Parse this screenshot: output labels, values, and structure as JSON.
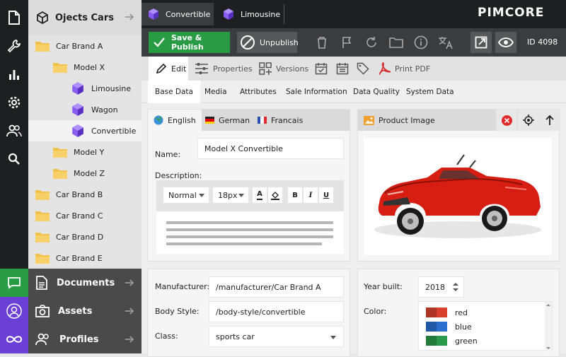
{
  "brand": {
    "logo_text": "PIMCORE"
  },
  "tabs": [
    {
      "label": "Convertible",
      "active": true
    },
    {
      "label": "Limousine",
      "active": false
    }
  ],
  "tree": {
    "title": "Ojects Cars",
    "nodes": [
      {
        "label": "Car Brand A",
        "type": "folder"
      },
      {
        "label": "Model X",
        "type": "folder"
      },
      {
        "label": "Limousine",
        "type": "object"
      },
      {
        "label": "Wagon",
        "type": "object"
      },
      {
        "label": "Convertible",
        "type": "object",
        "selected": true
      },
      {
        "label": "Model Y",
        "type": "folder"
      },
      {
        "label": "Model Z",
        "type": "folder"
      },
      {
        "label": "Car Brand B",
        "type": "folder"
      },
      {
        "label": "Car Brand C",
        "type": "folder"
      },
      {
        "label": "Car Brand D",
        "type": "folder"
      },
      {
        "label": "Car Brand E",
        "type": "folder"
      }
    ]
  },
  "bottom_nav": [
    {
      "label": "Documents"
    },
    {
      "label": "Assets"
    },
    {
      "label": "Profiles"
    }
  ],
  "toolbar": {
    "save_publish": "Save & Publish",
    "unpublish": "Unpublish",
    "id_text": "ID 4098"
  },
  "subtabs": [
    {
      "label": "Edit",
      "active": true
    },
    {
      "label": "Properties"
    },
    {
      "label": "Versions"
    },
    {
      "label": "Print PDF"
    }
  ],
  "sections": [
    {
      "label": "Base Data",
      "active": true
    },
    {
      "label": "Media"
    },
    {
      "label": "Attributes"
    },
    {
      "label": "Sale Information"
    },
    {
      "label": "Data Quality"
    },
    {
      "label": "System Data"
    }
  ],
  "languages": [
    {
      "label": "English",
      "active": true
    },
    {
      "label": "German"
    },
    {
      "label": "Francais"
    }
  ],
  "form": {
    "name_label": "Name:",
    "name_value": "Model X Convertible",
    "description_label": "Description:",
    "rte": {
      "format": "Normal",
      "size": "18px",
      "bold": "B",
      "italic": "I",
      "underline": "U",
      "color_letter": "A"
    },
    "manufacturer_label": "Manufacturer:",
    "manufacturer_value": "/manufacturer/Car Brand A",
    "bodystyle_label": "Body Style:",
    "bodystyle_value": "/body-style/convertible",
    "class_label": "Class:",
    "class_value": "sports car",
    "year_label": "Year built:",
    "year_value": "2018",
    "color_label": "Color:",
    "colors": [
      {
        "label": "red",
        "hex": "#d9412e"
      },
      {
        "label": "blue",
        "hex": "#2a6fd0"
      },
      {
        "label": "green",
        "hex": "#2a9a48"
      }
    ]
  },
  "image_panel": {
    "title": "Product Image"
  },
  "colors": {
    "accent_green": "#2a9b45",
    "purple": "#6c3fd6",
    "folder": "#f2c14a",
    "dark": "#1d1f21"
  }
}
